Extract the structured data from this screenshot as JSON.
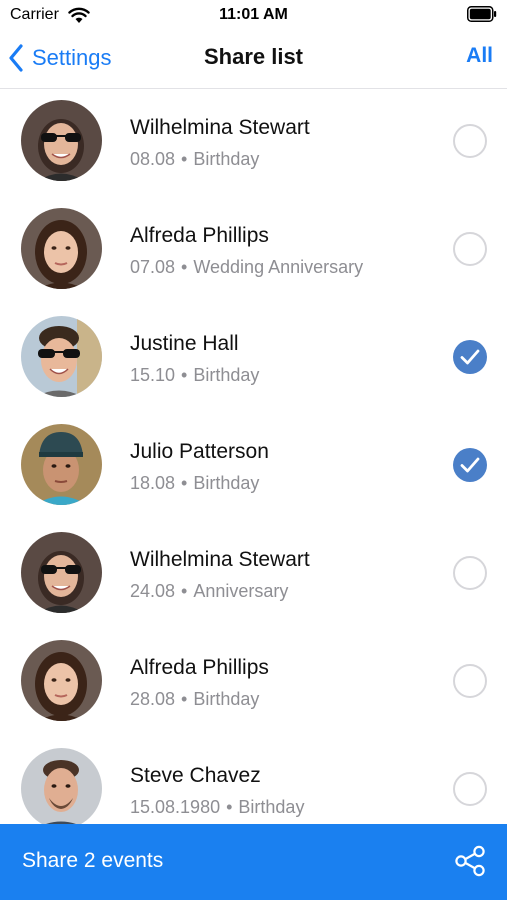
{
  "status_bar": {
    "carrier": "Carrier",
    "time": "11:01 AM"
  },
  "nav": {
    "back_label": "Settings",
    "title": "Share list",
    "right_action": "All"
  },
  "rows": [
    {
      "name": "Wilhelmina Stewart",
      "date": "08.08",
      "event": "Birthday",
      "selected": false
    },
    {
      "name": "Alfreda Phillips",
      "date": "07.08",
      "event": "Wedding Anniversary",
      "selected": false
    },
    {
      "name": "Justine Hall",
      "date": "15.10",
      "event": "Birthday",
      "selected": true
    },
    {
      "name": "Julio Patterson",
      "date": "18.08",
      "event": "Birthday",
      "selected": true
    },
    {
      "name": "Wilhelmina Stewart",
      "date": "24.08",
      "event": "Anniversary",
      "selected": false
    },
    {
      "name": "Alfreda Phillips",
      "date": "28.08",
      "event": "Birthday",
      "selected": false
    },
    {
      "name": "Steve Chavez",
      "date": "15.08.1980",
      "event": "Birthday",
      "selected": false
    }
  ],
  "share_bar": {
    "label": "Share 2 events",
    "icon": "share-icon"
  },
  "colors": {
    "accent": "#1a7cf5",
    "share_bar": "#1a80f0",
    "check_selected": "#4a7fc8"
  }
}
